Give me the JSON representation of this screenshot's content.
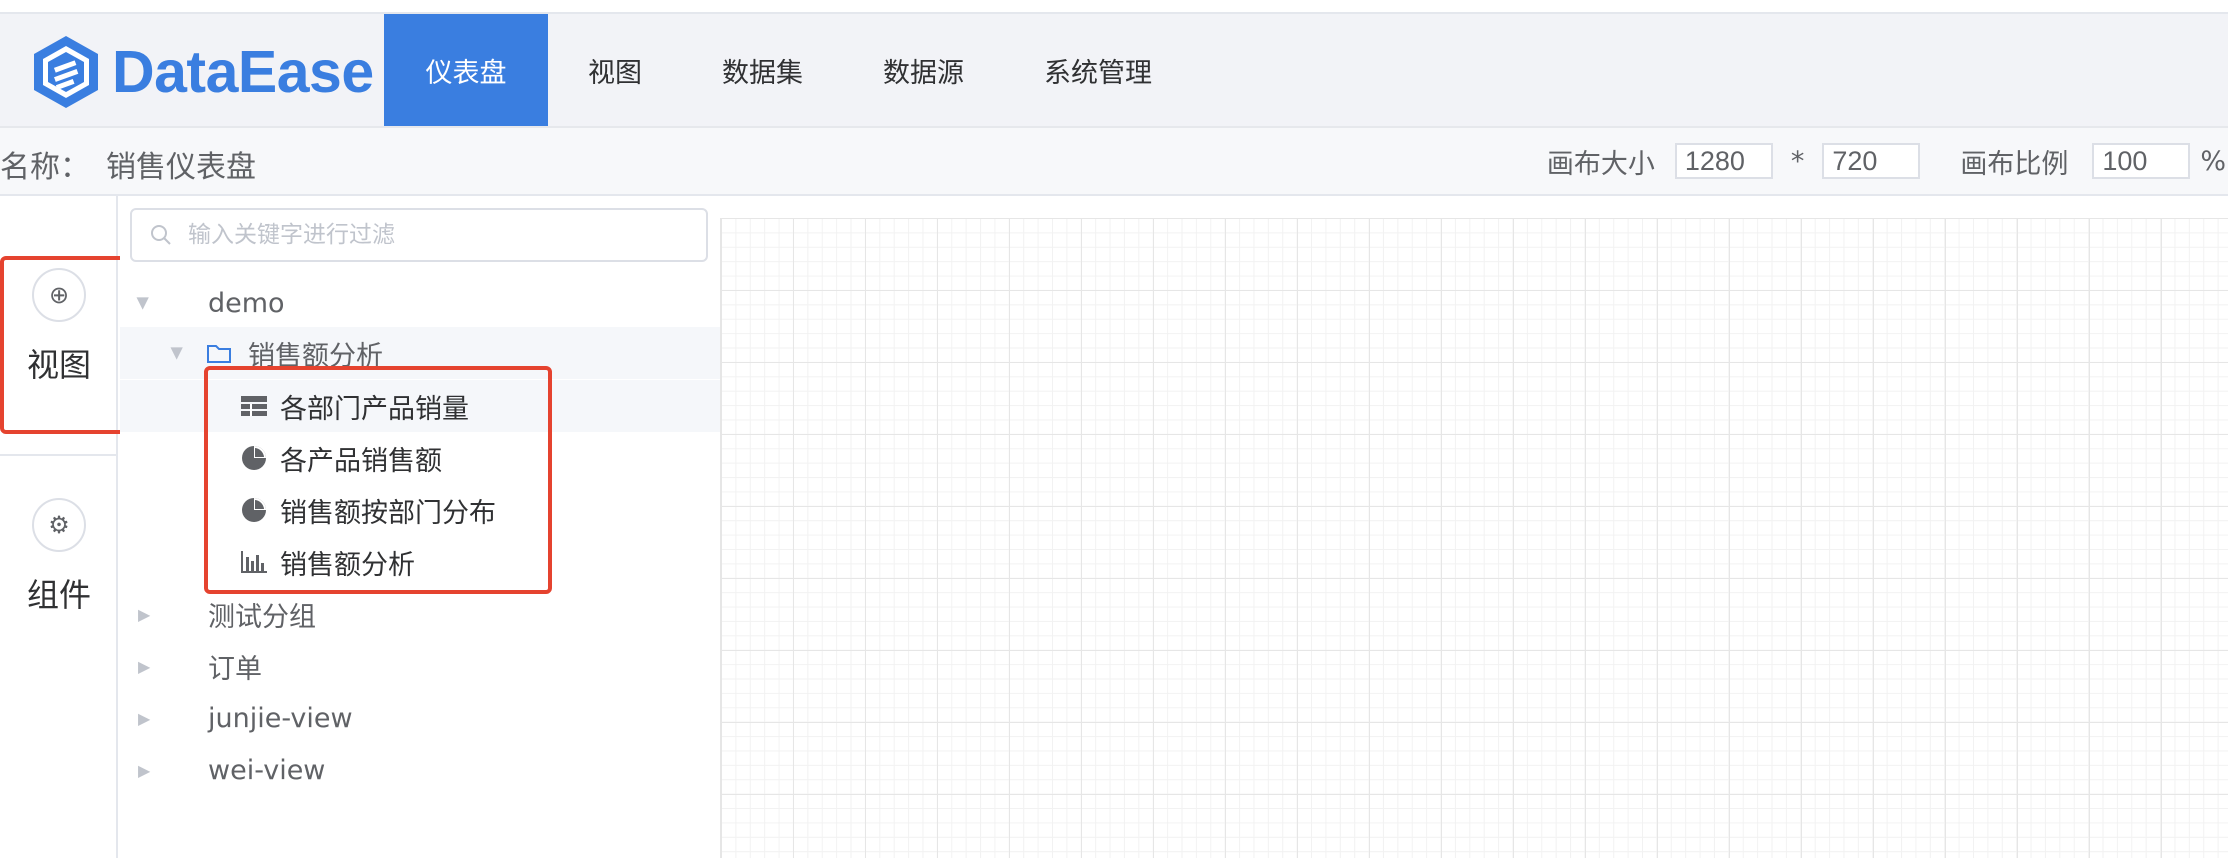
{
  "app": {
    "logo_text": "DataEase"
  },
  "nav": {
    "items": [
      {
        "label": "仪表盘"
      },
      {
        "label": "视图"
      },
      {
        "label": "数据集"
      },
      {
        "label": "数据源"
      },
      {
        "label": "系统管理"
      }
    ],
    "active": "仪表盘"
  },
  "subbar": {
    "name_label": "名称：",
    "name_value": "销售仪表盘",
    "canvas_size_label": "画布大小",
    "width": "1280",
    "times": "*",
    "height": "720",
    "canvas_ratio_label": "画布比例",
    "ratio": "100",
    "percent": "%"
  },
  "sidebar": {
    "view_label": "视图",
    "component_label": "组件"
  },
  "tree": {
    "search_placeholder": "输入关键字进行过滤",
    "nodes": {
      "demo": "demo",
      "folder": "销售额分析",
      "leaf1": "各部门产品销量",
      "leaf2": "各产品销售额",
      "leaf3": "销售额按部门分布",
      "leaf4": "销售额分析",
      "group2": "测试分组",
      "group3": "订单",
      "group4": "junjie-view",
      "group5": "wei-view"
    }
  },
  "colors": {
    "accent": "#3a7ee0",
    "highlight": "#e5432f"
  }
}
